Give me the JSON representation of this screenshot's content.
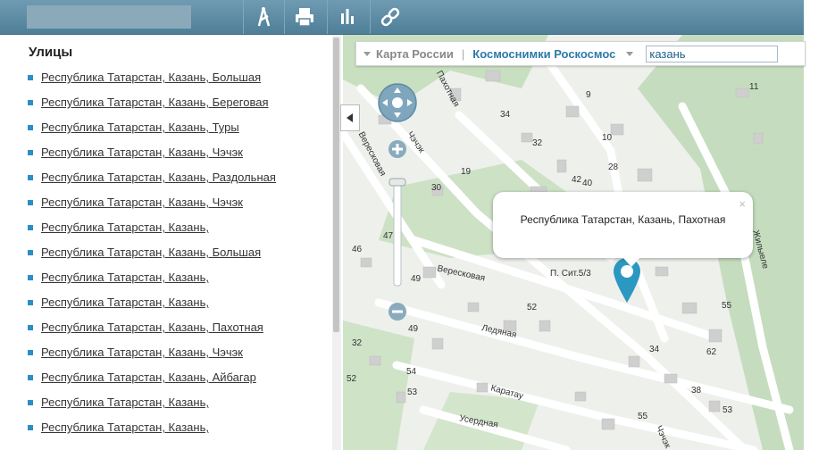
{
  "toolbar": {
    "tools": [
      {
        "name": "measure-icon"
      },
      {
        "name": "print-icon"
      },
      {
        "name": "statistics-icon"
      },
      {
        "name": "link-icon"
      }
    ]
  },
  "sidebar": {
    "title": "Улицы",
    "items": [
      "Республика Татарстан, Казань, Большая",
      "Республика Татарстан, Казань, Береговая",
      "Республика Татарстан, Казань, Туры",
      "Республика Татарстан, Казань, Чэчэк",
      "Республика Татарстан, Казань, Раздольная",
      "Республика Татарстан, Казань, Чэчэк",
      "Республика Татарстан, Казань,",
      "Республика Татарстан, Казань, Большая",
      "Республика Татарстан, Казань,",
      "Республика Татарстан, Казань,",
      "Республика Татарстан, Казань, Пахотная",
      "Республика Татарстан, Казань, Чэчэк",
      "Республика Татарстан, Казань, Айбагар",
      "Республика Татарстан, Казань,",
      "Республика Татарстан, Казань,"
    ]
  },
  "map": {
    "layer_russia": "Карта России",
    "separator": "|",
    "layer_satellite": "Космоснимки Роскосмос",
    "search_value": "казань",
    "popup_text": "Республика Татарстан, Казань, Пахотная",
    "popup_close": "×",
    "streets": [
      "Пахотная",
      "Чэчэк",
      "Вересковая",
      "Вересковая",
      "Ледяная",
      "Каратау",
      "Усердная",
      "Жилыеле",
      "Чэчэк",
      "П. Сит.5/3"
    ],
    "house_numbers": [
      "11",
      "9",
      "34",
      "30",
      "19",
      "32",
      "42",
      "28",
      "40",
      "46",
      "47",
      "49",
      "52",
      "55",
      "49",
      "52",
      "54",
      "62",
      "34",
      "38",
      "53",
      "55",
      "32",
      "53",
      "10"
    ]
  },
  "colors": {
    "accent": "#2a8ec7",
    "pin": "#2b98c2"
  }
}
